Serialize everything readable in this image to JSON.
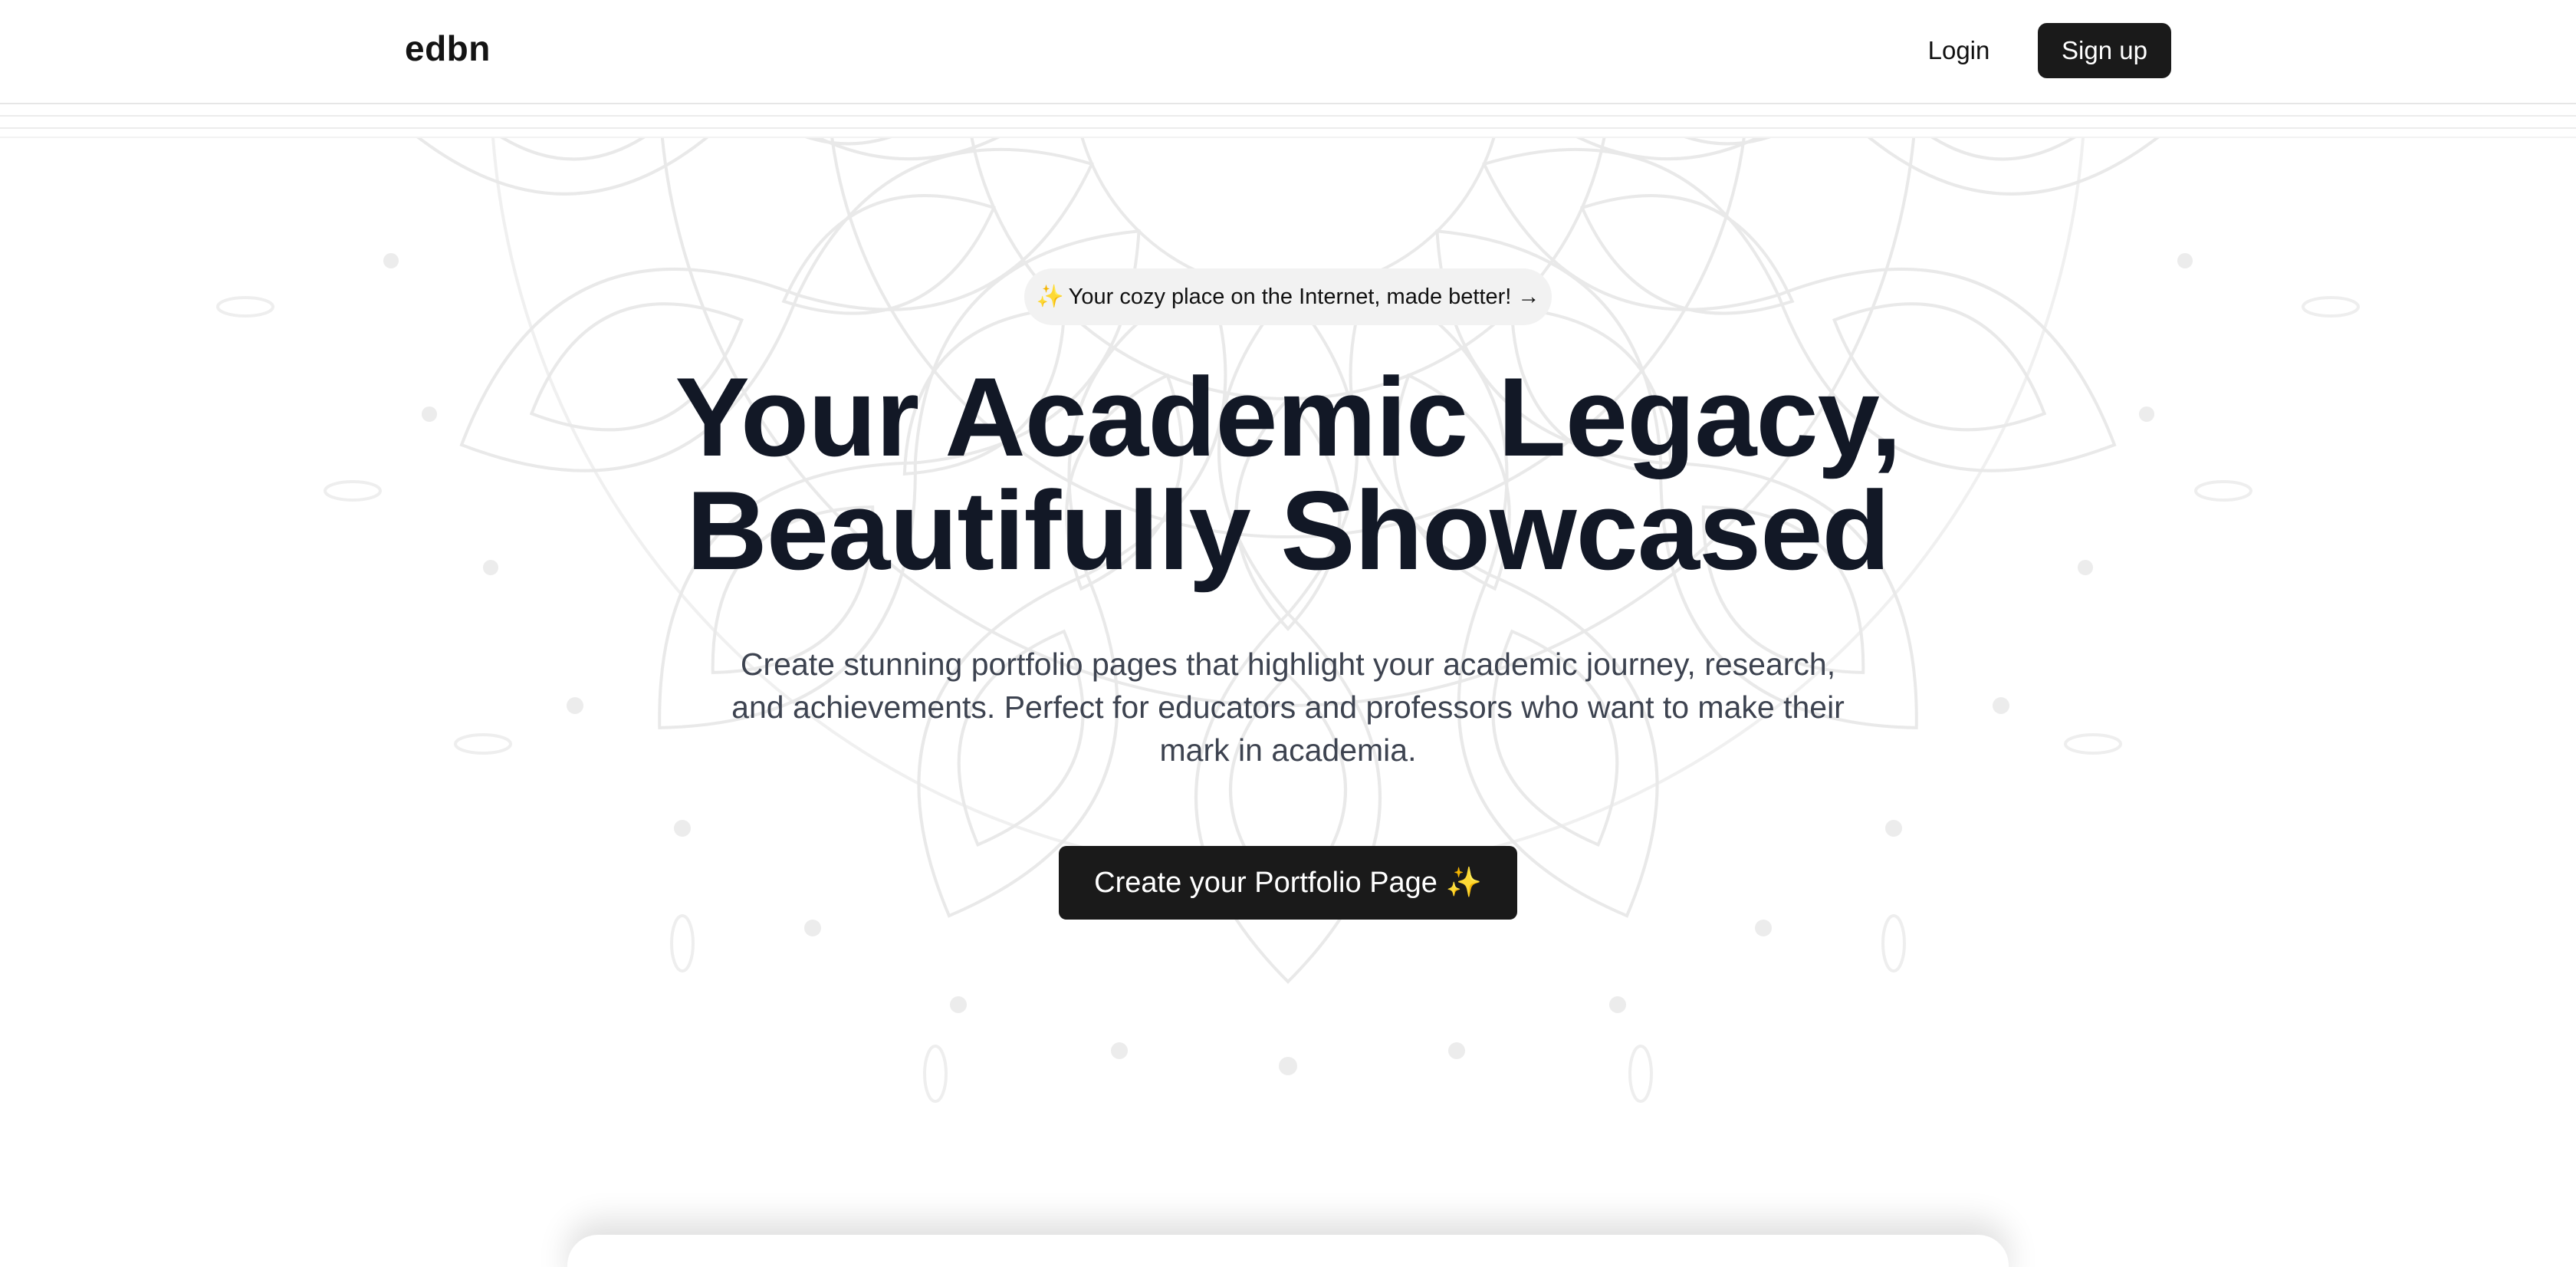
{
  "nav": {
    "logo": "edbn",
    "login_label": "Login",
    "signup_label": "Sign up"
  },
  "hero": {
    "pill_icon": "✨",
    "pill_text": "Your cozy place on the Internet, made better!",
    "pill_arrow": "→",
    "headline_line1": "Your Academic Legacy,",
    "headline_line2": "Beautifully Showcased",
    "subtext": "Create stunning portfolio pages that highlight your academic journey, research, and achievements. Perfect for educators and professors who want to make their mark in academia.",
    "cta_label": "Create your Portfolio Page",
    "cta_icon": "✨"
  },
  "colors": {
    "primary_button": "#1a1a1a",
    "headline": "#121826",
    "body_text": "#3d4350",
    "pill_bg": "#f2f2f2"
  },
  "icons": {
    "pill_sparkle": "sparkle-icon",
    "pill_arrow": "arrow-right-icon",
    "cta_sparkle": "sparkle-icon",
    "background": "mandala-pattern"
  }
}
